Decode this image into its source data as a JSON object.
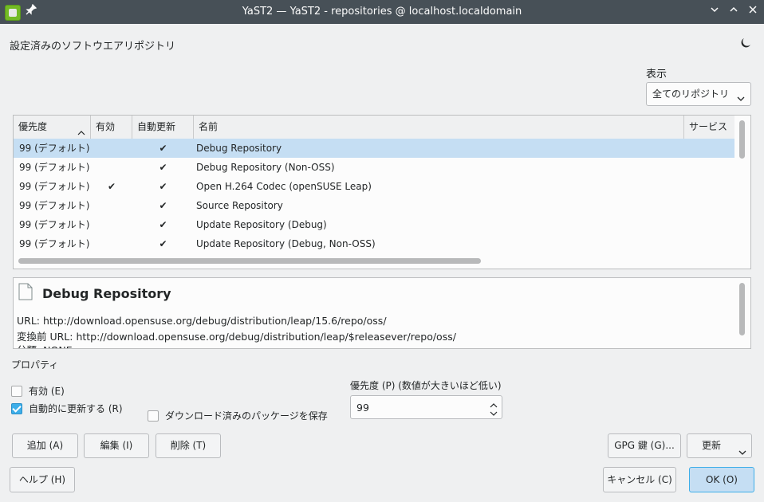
{
  "window": {
    "title": "YaST2 — YaST2 - repositories @ localhost.localdomain"
  },
  "section_title": "設定済みのソフトウエアリポジトリ",
  "view": {
    "label": "表示",
    "selected": "全てのリポジトリ"
  },
  "table": {
    "columns": [
      "優先度",
      "有効",
      "自動更新",
      "名前",
      "サービス"
    ],
    "rows": [
      {
        "priority": "99 (デフォルト)",
        "enabled": "",
        "autorefresh": "✔",
        "name": "Debug Repository",
        "service": ""
      },
      {
        "priority": "99 (デフォルト)",
        "enabled": "",
        "autorefresh": "✔",
        "name": "Debug Repository (Non-OSS)",
        "service": ""
      },
      {
        "priority": "99 (デフォルト)",
        "enabled": "✔",
        "autorefresh": "✔",
        "name": "Open H.264 Codec (openSUSE Leap)",
        "service": ""
      },
      {
        "priority": "99 (デフォルト)",
        "enabled": "",
        "autorefresh": "✔",
        "name": "Source Repository",
        "service": ""
      },
      {
        "priority": "99 (デフォルト)",
        "enabled": "",
        "autorefresh": "✔",
        "name": "Update Repository (Debug)",
        "service": ""
      },
      {
        "priority": "99 (デフォルト)",
        "enabled": "",
        "autorefresh": "✔",
        "name": "Update Repository (Debug, Non-OSS)",
        "service": ""
      }
    ]
  },
  "detail": {
    "title": "Debug Repository",
    "url_line": "URL: http://download.opensuse.org/debug/distribution/leap/15.6/repo/oss/",
    "raw_url_line": "変換前 URL: http://download.opensuse.org/debug/distribution/leap/$releasever/repo/oss/",
    "category_line": "分類: NONE"
  },
  "properties": {
    "label": "プロパティ",
    "enabled_label": "有効 (E)",
    "enabled_checked": false,
    "autorefresh_label": "自動的に更新する (R)",
    "autorefresh_checked": true,
    "keep_packages_label": "ダウンロード済みのパッケージを保存",
    "keep_packages_checked": false,
    "priority_label": "優先度 (P) (数値が大きいほど低い)",
    "priority_value": "99"
  },
  "buttons": {
    "add": "追加 (A)",
    "edit": "編集 (I)",
    "delete": "削除 (T)",
    "gpg": "GPG 鍵 (G)...",
    "refresh": "更新",
    "help": "ヘルプ (H)",
    "cancel": "キャンセル (C)",
    "ok": "OK (O)"
  },
  "colors": {
    "titlebar": "#475057",
    "selection": "#c5def3",
    "accent": "#3daee9"
  }
}
